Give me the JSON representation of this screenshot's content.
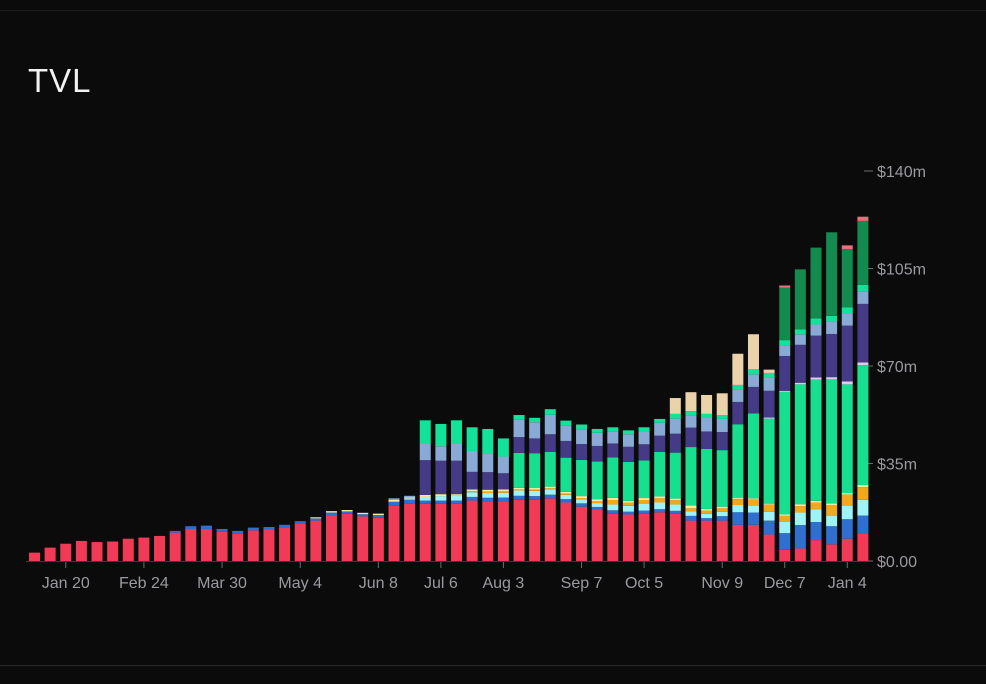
{
  "title": "TVL",
  "chart_data": {
    "type": "bar",
    "stacked": true,
    "title": "TVL",
    "ylim": [
      0,
      140
    ],
    "yticks": [
      {
        "value": 0,
        "label": "$0.00"
      },
      {
        "value": 35,
        "label": "$35m"
      },
      {
        "value": 70,
        "label": "$70m"
      },
      {
        "value": 105,
        "label": "$105m"
      },
      {
        "value": 140,
        "label": "$140m"
      }
    ],
    "xticks": [
      {
        "index": 2,
        "label": "Jan 20"
      },
      {
        "index": 7,
        "label": "Feb 24"
      },
      {
        "index": 12,
        "label": "Mar 30"
      },
      {
        "index": 17,
        "label": "May 4"
      },
      {
        "index": 22,
        "label": "Jun 8"
      },
      {
        "index": 26,
        "label": "Jul 6"
      },
      {
        "index": 30,
        "label": "Aug 3"
      },
      {
        "index": 35,
        "label": "Sep 7"
      },
      {
        "index": 39,
        "label": "Oct 5"
      },
      {
        "index": 44,
        "label": "Nov 9"
      },
      {
        "index": 48,
        "label": "Dec 7"
      },
      {
        "index": 52,
        "label": "Jan 4"
      }
    ],
    "colors": [
      "#f03a56",
      "#2f6fd0",
      "#9ef3f6",
      "#f0a81c",
      "#f5eba5",
      "#16df8f",
      "#e0c8f0",
      "#453a85",
      "#8aaad6",
      "#13e29a",
      "#ebd2aa",
      "#138a4e",
      "#e8707a"
    ],
    "bars": [
      [
        3
      ],
      [
        4.8
      ],
      [
        6.2
      ],
      [
        7.2
      ],
      [
        6.8
      ],
      [
        7
      ],
      [
        8
      ],
      [
        8.4
      ],
      [
        9
      ],
      [
        10.2,
        0.6
      ],
      [
        11.5,
        1
      ],
      [
        11.5,
        1.2
      ],
      [
        10.5,
        1
      ],
      [
        9.8,
        1
      ],
      [
        11,
        1
      ],
      [
        11.3,
        0.9
      ],
      [
        12,
        1
      ],
      [
        13.5,
        0.8
      ],
      [
        14.5,
        0.8,
        0,
        0,
        0.4
      ],
      [
        16.5,
        0.9,
        0,
        0,
        0.5
      ],
      [
        17,
        0.8,
        0,
        0,
        0.5
      ],
      [
        16,
        0.8,
        0,
        0,
        0.5
      ],
      [
        15.5,
        1,
        0,
        0,
        0.5
      ],
      [
        20,
        1.2,
        0.3,
        0,
        0.5,
        0,
        0,
        0,
        0.5
      ],
      [
        20.5,
        1.5,
        0.5,
        0,
        0.4,
        0,
        0,
        0,
        0.5
      ],
      [
        20.5,
        1.2,
        1.3,
        0,
        0.7,
        0,
        0,
        12.5,
        5.8,
        8.5
      ],
      [
        20.5,
        1.2,
        1.6,
        0,
        0.7,
        0,
        0,
        12,
        5.2,
        8
      ],
      [
        20.5,
        1.2,
        1.7,
        0,
        0.6,
        0,
        0,
        12,
        6,
        8.5
      ],
      [
        21.7,
        1.3,
        1.7,
        0.4,
        0.6,
        0,
        0,
        6.3,
        7.5,
        8.5
      ],
      [
        21.5,
        1.2,
        1.7,
        0.5,
        0.7,
        0,
        0,
        6.3,
        6.5,
        9
      ],
      [
        21.5,
        1.3,
        1.7,
        0.5,
        0.7,
        0,
        0,
        5.8,
        6,
        6.5
      ],
      [
        22,
        1.4,
        1.9,
        0.4,
        0.6,
        12.5,
        0,
        5.7,
        6.4,
        1.5
      ],
      [
        22,
        1.3,
        1.9,
        0.4,
        0.6,
        12.5,
        0,
        5.3,
        5.8,
        1.6
      ],
      [
        22.5,
        1.3,
        1.9,
        0.4,
        0.6,
        12.5,
        0,
        6.3,
        7,
        2
      ],
      [
        21,
        1.2,
        1.6,
        0.4,
        0.6,
        12.3,
        0,
        6,
        5.5,
        1.8
      ],
      [
        19.5,
        1.2,
        1.5,
        0.4,
        0.7,
        13,
        0,
        5.7,
        5.3,
        1.7
      ],
      [
        18.5,
        0.9,
        1.4,
        0.6,
        0.8,
        13.5,
        0,
        5.6,
        4.7,
        1.4
      ],
      [
        17,
        1.2,
        2.1,
        1.6,
        0.8,
        14.5,
        0,
        5,
        4.4,
        1.4
      ],
      [
        16.7,
        1,
        2.1,
        1.2,
        0.6,
        14,
        0,
        5.4,
        4.5,
        1.4
      ],
      [
        17,
        1.1,
        2.5,
        1.3,
        0.7,
        13.5,
        0,
        5.8,
        4.6,
        1.5
      ],
      [
        17.5,
        1.1,
        2.4,
        1.5,
        0.7,
        16,
        0,
        5.8,
        4.6,
        1.4
      ],
      [
        17,
        1,
        2.3,
        1.5,
        0.6,
        16.5,
        0,
        6.8,
        5.4,
        1.7,
        5.7
      ],
      [
        14.5,
        1.7,
        1.7,
        1,
        1,
        21,
        0,
        7,
        4.3,
        1.6,
        6.8
      ],
      [
        14.5,
        0.9,
        1.5,
        1.2,
        0.6,
        21.5,
        0,
        6.3,
        5,
        1.3,
        6.8
      ],
      [
        14.5,
        1.6,
        1.6,
        1.2,
        0.6,
        20.3,
        0,
        6.5,
        4.7,
        1.4,
        7.8
      ],
      [
        13,
        4.5,
        2.6,
        2.1,
        0.4,
        26.5,
        0,
        8,
        4.3,
        1.8,
        11.2
      ],
      [
        13,
        4.4,
        2.6,
        2.1,
        0.4,
        30.5,
        0,
        9.5,
        4.5,
        1.8,
        12.6
      ],
      [
        9.5,
        5,
        3.2,
        2.5,
        0.4,
        30.5,
        0.4,
        9.6,
        4.6,
        1.8,
        1.2
      ],
      [
        4,
        6,
        4,
        2.2,
        0.5,
        44,
        0.4,
        12.5,
        3.9,
        1.8,
        0,
        18.8,
        0.8
      ],
      [
        4.5,
        8.4,
        4.5,
        2.3,
        0.7,
        43,
        0.6,
        13.6,
        3.8,
        1.8,
        0,
        21.5
      ],
      [
        7.5,
        6.5,
        4.5,
        2.5,
        0.6,
        43.5,
        0.8,
        15,
        4,
        2.2,
        0,
        25.4
      ],
      [
        6,
        6.5,
        3.8,
        3.8,
        0.6,
        44.5,
        0.8,
        15.5,
        4.5,
        2,
        0,
        30
      ],
      [
        8,
        7,
        5,
        3.8,
        0.6,
        39,
        1.1,
        20,
        4.5,
        2,
        0,
        21,
        1.3
      ],
      [
        10,
        6.3,
        5.7,
        4.5,
        0.8,
        43,
        1,
        21,
        4.5,
        2.3,
        0,
        23,
        1.5
      ]
    ]
  }
}
